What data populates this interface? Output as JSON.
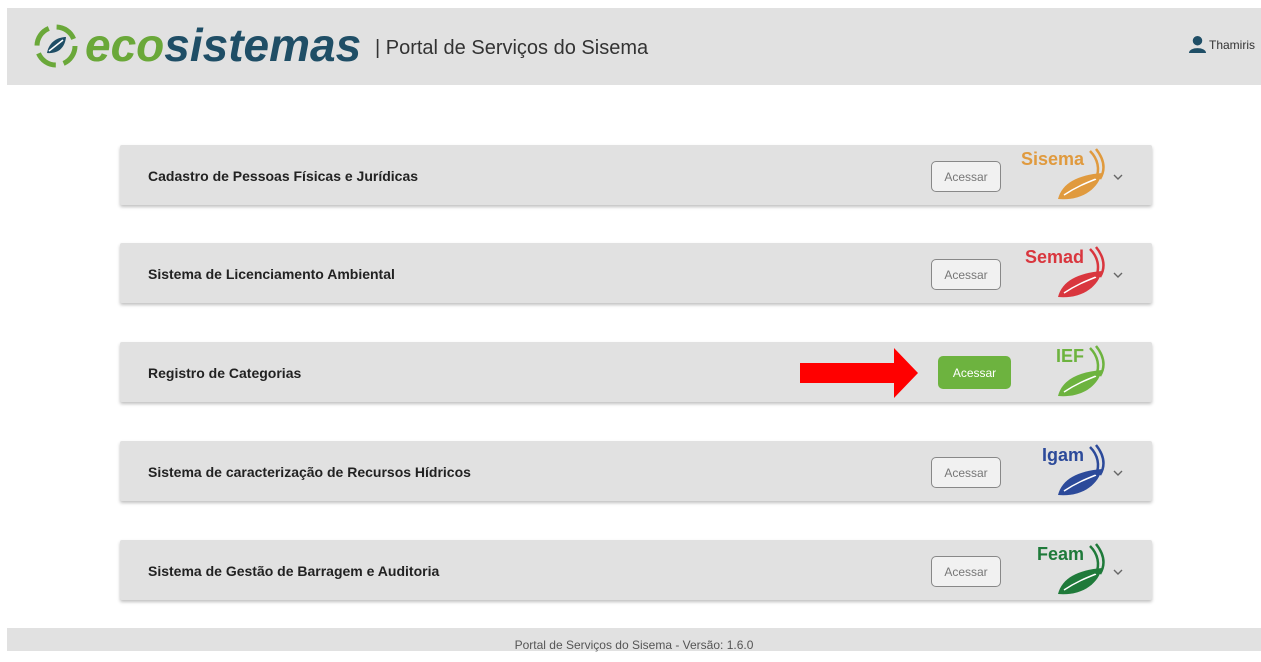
{
  "header": {
    "logo_eco": "eco",
    "logo_sistemas": "sistemas",
    "portal_title": "| Portal de Serviços do Sisema",
    "user_name": "Thamiris",
    "user_icon": "user-icon"
  },
  "cards": [
    {
      "title": "Cadastro de Pessoas Físicas e Jurídicas",
      "button": "Acessar",
      "brand": "Sisema",
      "brand_color": "#e09a3e",
      "active": false
    },
    {
      "title": "Sistema de Licenciamento Ambiental",
      "button": "Acessar",
      "brand": "Semad",
      "brand_color": "#d9363e",
      "active": false
    },
    {
      "title": "Registro de Categorias",
      "button": "Acessar",
      "brand": "IEF",
      "brand_color": "#6db33f",
      "active": true
    },
    {
      "title": "Sistema de caracterização de Recursos Hídricos",
      "button": "Acessar",
      "brand": "Igam",
      "brand_color": "#2c4a9a",
      "active": false
    },
    {
      "title": "Sistema de Gestão de Barragem e Auditoria",
      "button": "Acessar",
      "brand": "Feam",
      "brand_color": "#1f7a3a",
      "active": false
    }
  ],
  "annotation": {
    "arrow_color": "#ff0000"
  },
  "footer": {
    "text": "Portal de Serviços do Sisema - Versão: 1.6.0"
  }
}
